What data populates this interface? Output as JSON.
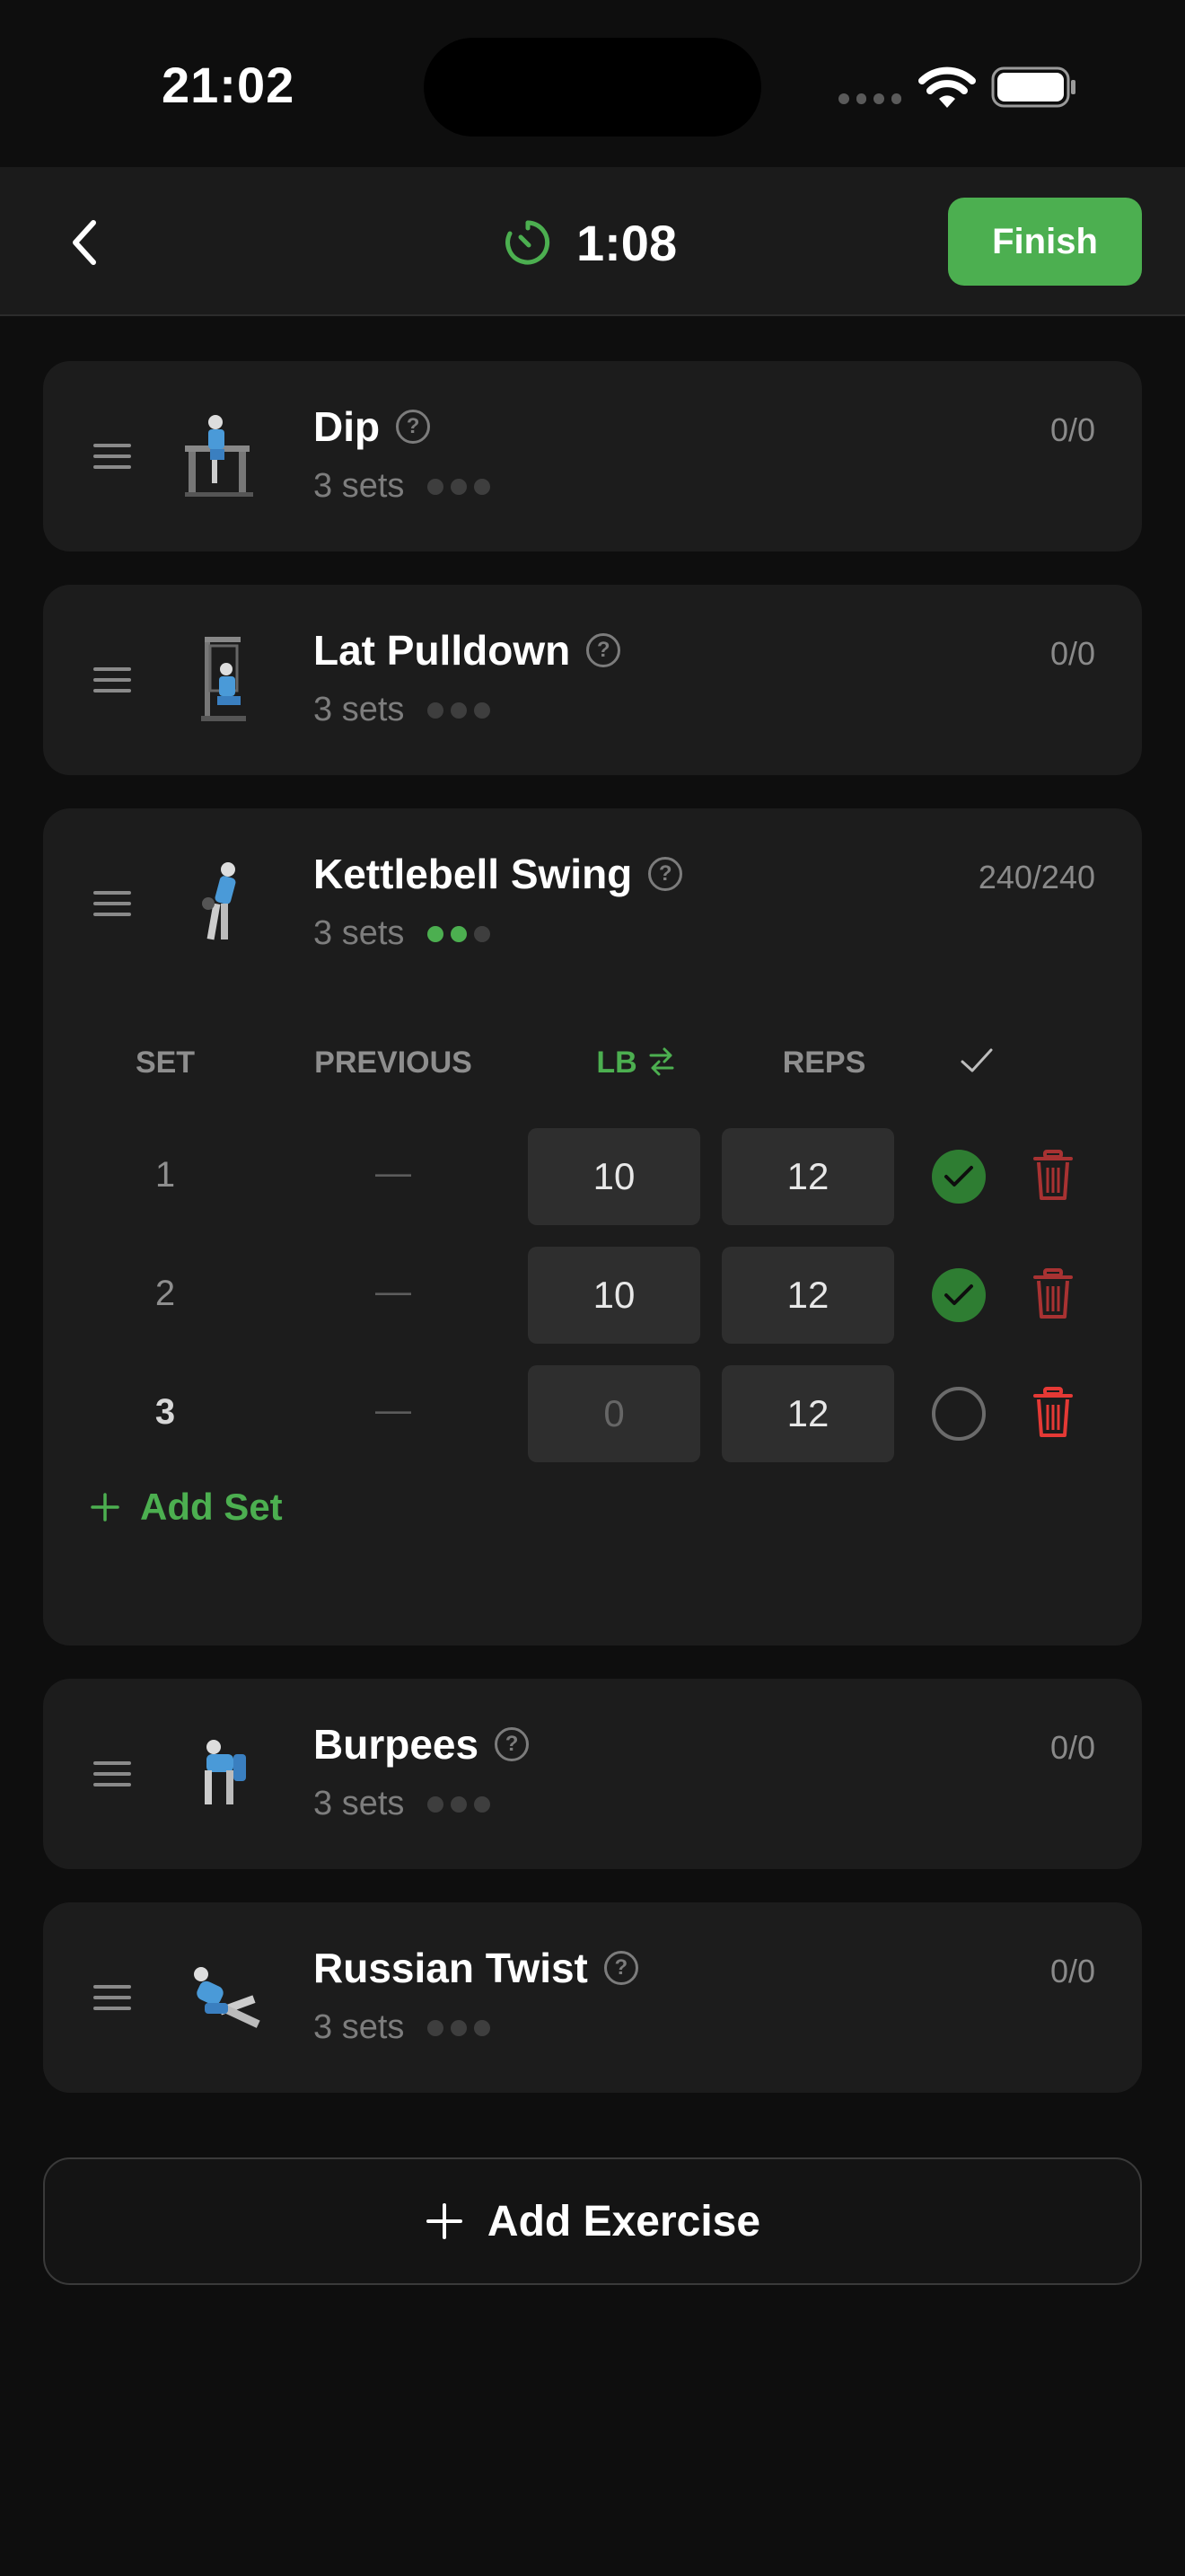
{
  "status_bar": {
    "time": "21:02"
  },
  "nav": {
    "timer": "1:08",
    "finish_label": "Finish"
  },
  "exercises": [
    {
      "name": "Dip",
      "sets_label": "3 sets",
      "count": "0/0",
      "completed_dots": 0
    },
    {
      "name": "Lat Pulldown",
      "sets_label": "3 sets",
      "count": "0/0",
      "completed_dots": 0
    },
    {
      "name": "Kettlebell Swing",
      "sets_label": "3 sets",
      "count": "240/240",
      "completed_dots": 2
    },
    {
      "name": "Burpees",
      "sets_label": "3 sets",
      "count": "0/0",
      "completed_dots": 0
    },
    {
      "name": "Russian Twist",
      "sets_label": "3 sets",
      "count": "0/0",
      "completed_dots": 0
    }
  ],
  "set_table": {
    "headers": {
      "set": "SET",
      "previous": "PREVIOUS",
      "lb": "LB",
      "reps": "REPS"
    },
    "rows": [
      {
        "set": "1",
        "previous": "—",
        "lb": "10",
        "reps": "12",
        "done": true
      },
      {
        "set": "2",
        "previous": "—",
        "lb": "10",
        "reps": "12",
        "done": true
      },
      {
        "set": "3",
        "previous": "—",
        "lb": "0",
        "reps": "12",
        "done": false
      }
    ],
    "add_set_label": "Add Set"
  },
  "add_exercise_label": "Add Exercise",
  "colors": {
    "accent": "#4caf50",
    "danger": "#e53935",
    "card": "#1c1c1c",
    "background": "#0e0e0e"
  }
}
